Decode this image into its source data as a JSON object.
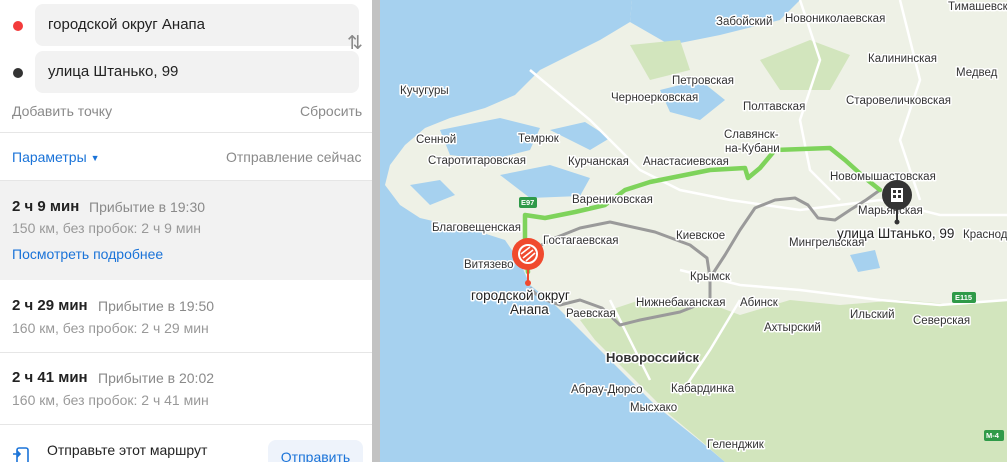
{
  "waypoints": [
    {
      "value": "городской округ Анапа",
      "color": "#f33b3b"
    },
    {
      "value": "улица Штанько, 99",
      "color": "#333333"
    }
  ],
  "swap_icon": "swap-vertical-icon",
  "add_point": "Добавить точку",
  "reset": "Сбросить",
  "params_label": "Параметры",
  "departure": "Отправление сейчас",
  "routes": [
    {
      "time": "2 ч 9 мин",
      "arrival": "Прибытие в 19:30",
      "details": "150 км, без пробок: 2 ч 9 мин",
      "more": "Посмотреть подробнее"
    },
    {
      "time": "2 ч 29 мин",
      "arrival": "Прибытие в 19:50",
      "details": "160 км, без пробок: 2 ч 29 мин"
    },
    {
      "time": "2 ч 41 мин",
      "arrival": "Прибытие в 20:02",
      "details": "160 км, без пробок: 2 ч 41 мин"
    }
  ],
  "send": {
    "text": "Отправьте этот маршрут",
    "button": "Отправить",
    "icon": "phone-send-icon"
  },
  "map": {
    "places": {
      "zabosky": "Забойский",
      "novonik": "Новониколаевская",
      "timash": "Тимашевск",
      "kalin": "Калининская",
      "medved": "Медвед",
      "kuchu": "Кучугуры",
      "petrov": "Петровская",
      "chernoerk": "Черноерковская",
      "poltav": "Полтавская",
      "starovel": "Старовеличковская",
      "sennoy": "Сенной",
      "temryuk": "Темрюк",
      "slav1": "Славянск-",
      "slav2": "на-Кубани",
      "novomysh": "Новомышастовская",
      "starotit": "Старотитаровская",
      "kurchan": "Курчанская",
      "anastas": "Анастасиевская",
      "varenik": "Варениковская",
      "marian": "Марьянская",
      "krasnod": "Краснод",
      "blagov": "Благовещенская",
      "kievsk": "Киевское",
      "mingrel": "Мингрельская",
      "gostag": "Гостагаевская",
      "vityaz": "Витязево",
      "krymsk": "Крымск",
      "anapa1": "городской округ",
      "anapa2": "Анапа",
      "nizhnebak": "Нижнебаканская",
      "abinsk": "Абинск",
      "ilsky": "Ильский",
      "seversk": "Северская",
      "raevsk": "Раевская",
      "akhtyr": "Ахтырский",
      "novoros": "Новороссийск",
      "abrau": "Абрау-Дюрсо",
      "kabard": "Кабардинка",
      "myskhako": "Мысхако",
      "gelend": "Геленджик",
      "dest": "улица Штанько, 99",
      "e97": "E97",
      "e115": "E115",
      "m4": "М-4"
    },
    "colors": {
      "sea": "#a6d1ef",
      "land": "#eef1e6",
      "forest": "#d2e5bd",
      "route": "#7ed35b",
      "alt_route": "#9a9a9a",
      "pin": "#f04a2e"
    },
    "start_icon": "route-start-pin-icon",
    "finish_icon": "building-pin-icon"
  }
}
